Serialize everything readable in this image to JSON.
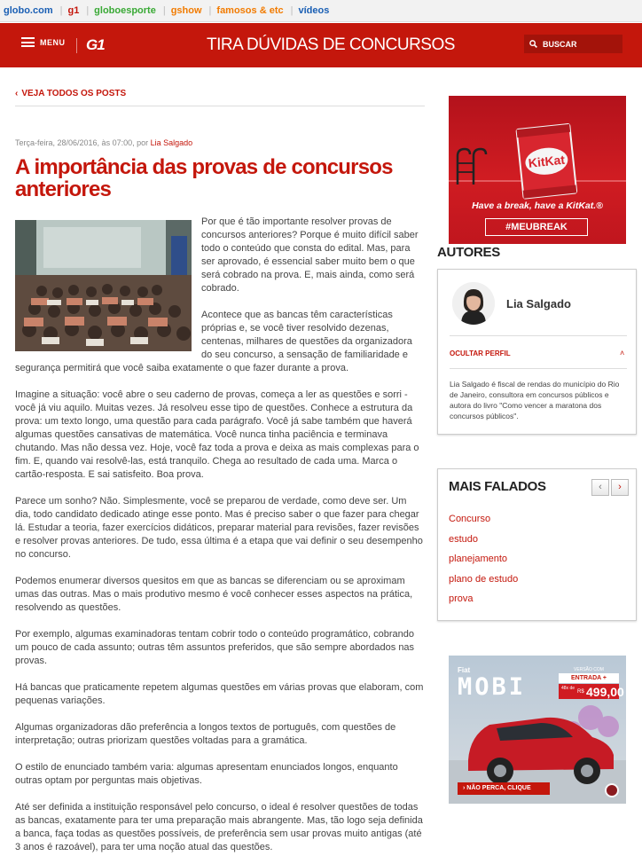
{
  "globo_bar": {
    "links": [
      "globo.com",
      "g1",
      "globoesporte",
      "gshow",
      "famosos & etc",
      "vídeos"
    ]
  },
  "header": {
    "menu_label": "MENU",
    "logo": "G1",
    "blog_title": "TIRA DÚVIDAS DE CONCURSOS",
    "search_label": "BUSCAR"
  },
  "post": {
    "back_link": "VEJA TODOS OS POSTS",
    "date_prefix": "Terça-feira, 28/06/2016, às 07:00, por",
    "author": "Lia Salgado",
    "title": "A importância das provas de concursos anteriores",
    "paragraphs": [
      "Por que é tão importante resolver provas de concursos anteriores? Porque é muito difícil saber todo o conteúdo que consta do edital. Mas, para ser aprovado, é essencial saber muito bem o que será cobrado na prova. E, mais ainda, como será cobrado.",
      "Acontece que as bancas têm características próprias e, se você tiver resolvido dezenas, centenas, milhares de questões da organizadora do seu concurso, a sensação de familiaridade e segurança permitirá que você saiba exatamente o que fazer durante a prova.",
      "Imagine a situação: você abre o seu caderno de provas, começa a ler as questões e sorri - você já viu aquilo. Muitas vezes. Já resolveu esse tipo de questões. Conhece a estrutura da prova: um texto longo, uma questão para cada parágrafo. Você já sabe também que haverá algumas questões cansativas de matemática. Você nunca tinha paciência e terminava chutando. Mas não dessa vez. Hoje, você faz toda a prova e deixa as mais complexas para o fim. E, quando vai resolvê-las, está tranquilo. Chega ao resultado de cada uma. Marca o cartão-resposta. E sai satisfeito. Boa prova.",
      "Parece um sonho? Não. Simplesmente, você se preparou de verdade, como deve ser. Um dia, todo candidato dedicado atinge esse ponto. Mas é preciso saber o que fazer para chegar lá. Estudar a teoria, fazer exercícios didáticos, preparar material para revisões, fazer revisões e resolver provas anteriores. De tudo, essa última é a etapa que vai definir o seu desempenho no concurso.",
      "Podemos enumerar diversos quesitos em que as bancas se diferenciam ou se aproximam umas das outras. Mas o mais produtivo mesmo é você conhecer esses aspectos na prática, resolvendo as questões.",
      "Por exemplo, algumas examinadoras tentam cobrir todo o conteúdo programático, cobrando um pouco de cada assunto; outras têm assuntos preferidos, que são sempre abordados nas provas.",
      "Há bancas que praticamente repetem algumas questões em várias provas que elaboram, com pequenas variações.",
      "Algumas organizadoras dão preferência a longos textos de português, com questões de interpretação; outras priorizam questões voltadas para a gramática.",
      "O estilo de enunciado também varia: algumas apresentam enunciados longos, enquanto outras optam por perguntas mais objetivas.",
      "Até ser definida a instituição responsável pelo concurso, o ideal é resolver questões de todas as bancas, exatamente para ter uma preparação mais abrangente. Mas, tão logo seja definida a banca, faça todas as questões possíveis, de preferência sem usar provas muito antigas (até 3 anos é razoável), para ter uma noção atual das questões."
    ]
  },
  "sidebar": {
    "ad_kitkat": {
      "slogan": "Have a break, have a KitKat.®",
      "hashtag": "#MEUBREAK",
      "brand": "KitKat"
    },
    "authors_heading": "AUTORES",
    "author": {
      "name": "Lia Salgado",
      "toggle": "OCULTAR PERFIL",
      "bio": "Lia Salgado é fiscal de rendas do município do Rio de Janeiro, consultora em concursos públicos e autora do livro \"Como vencer a maratona dos concursos públicos\"."
    },
    "mais_falados": {
      "heading": "MAIS FALADOS",
      "prev": "‹",
      "next": "›",
      "tags": [
        "Concurso",
        "estudo",
        "planejamento",
        "plano de estudo",
        "prova"
      ]
    },
    "ad_fiat": {
      "brand": "Fiat",
      "model": "MOBI",
      "version_line": "VERSÃO COM",
      "entrada": "ENTRADA +",
      "installments": "48x de",
      "currency": "R$",
      "price": "499,00",
      "cta": "› NÃO PERCA, CLIQUE"
    }
  },
  "colors": {
    "brand_red": "#c4170c",
    "text": "#444444"
  }
}
